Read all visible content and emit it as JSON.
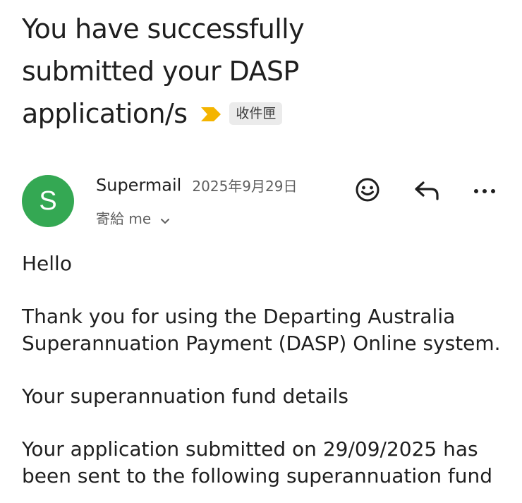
{
  "email": {
    "subject": "You have successfully submitted your DASP application/s",
    "label": "收件匣",
    "sender": {
      "avatar_letter": "S",
      "name": "Supermail",
      "date": "2025年9月29日",
      "recipient": "寄給 me"
    },
    "actions": {
      "react_icon": "emoji-smile-icon",
      "reply_icon": "reply-icon",
      "more_icon": "more-horizontal-icon"
    },
    "body": {
      "greeting": "Hello",
      "p1_line1": "Thank you for using the Departing Australia",
      "p1_line2": "Superannuation Payment (DASP) Online system.",
      "p2": "Your superannuation fund details",
      "p3_line1": "Your application submitted on 29/09/2025 has",
      "p3_line2": "been sent to the following superannuation fund"
    }
  },
  "colors": {
    "avatar": "#34a853",
    "importance_marker": "#f4b400",
    "label_bg": "#ebebeb"
  }
}
